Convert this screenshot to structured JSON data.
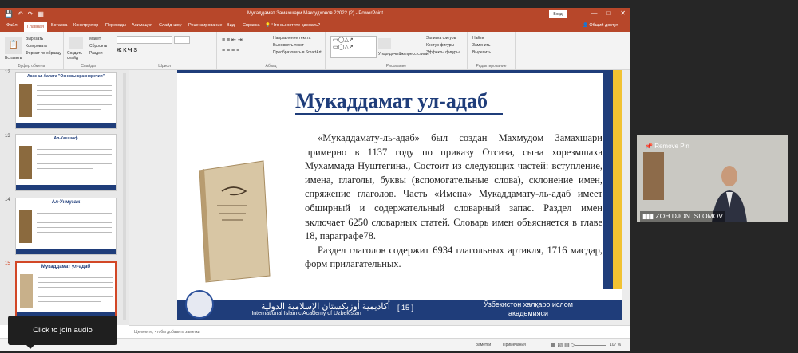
{
  "window": {
    "title": "Мукаддамат Замахшари Максудхонов 22022 (2)  -  PowerPoint",
    "enter_button": "Вход",
    "quick_access": [
      "save-icon",
      "undo-icon",
      "redo-icon",
      "present-icon"
    ],
    "window_controls": [
      "minimize-icon",
      "restore-icon",
      "close-icon"
    ]
  },
  "ribbon_tabs": [
    "Файл",
    "Главная",
    "Вставка",
    "Конструктор",
    "Переходы",
    "Анимация",
    "Слайд-шоу",
    "Рецензирование",
    "Вид",
    "Справка",
    "Что вы хотите сделать?"
  ],
  "ribbon_tab_active": "Главная",
  "share_label": "Общий доступ",
  "ribbon_groups": {
    "clipboard": {
      "caption": "Буфер обмена",
      "paste": "Вставить",
      "cut": "Вырезать",
      "copy": "Копировать",
      "format": "Формат по образцу"
    },
    "slides": {
      "caption": "Слайды",
      "new_slide": "Создать слайд",
      "layout": "Макет",
      "reset": "Сбросить",
      "section": "Раздел"
    },
    "font": {
      "caption": "Шрифт"
    },
    "paragraph": {
      "caption": "Абзац",
      "text_direction": "Направление текста",
      "align_text": "Выровнять текст",
      "smartart": "Преобразовать в SmartArt"
    },
    "drawing": {
      "caption": "Рисование",
      "arrange": "Упорядочить",
      "quick_styles": "Экспресс-стили",
      "fill": "Заливка фигуры",
      "outline": "Контур фигуры",
      "effects": "Эффекты фигуры"
    },
    "editing": {
      "caption": "Редактирование",
      "find": "Найти",
      "replace": "Заменить",
      "select": "Выделить"
    }
  },
  "thumbnails": [
    {
      "num": "12",
      "title": "Асас ал-балага \"Основы красноречия\""
    },
    {
      "num": "13",
      "title": "Ал-Кашшоф"
    },
    {
      "num": "14",
      "title": "Ал-Унмузаж"
    },
    {
      "num": "15",
      "title": "Мукаддамат ул-адаб"
    }
  ],
  "slide": {
    "title": "Мукаддамат ул-адаб",
    "paragraph1": "«Мукаддамату-ль-адаб» был создан Махмудом Замахшари примерно в 1137 году по приказу Отсиза, сына хорезмшаха Мухаммада Нуштегина., Состоит из следующих частей: вступление, имена, глаголы, буквы (вспомогательные слова), склонение имен, спряжение глаголов. Часть «Имена» Мукаддамату-ль-адаб имеет обширный и содержательный словарный запас. Раздел имен включает 6250 словарных статей. Словарь имен объясняется в главе 18, параграфе78.",
    "paragraph2": "Раздел глаголов содержит 6934 глагольных артикля, 1716 масдар, форм прилагательных.",
    "footer_arabic": "أكاديمية أوزبكستان الإسلامية الدولية",
    "footer_english": "International Islamic Academy of Uzbekistan",
    "page_number": "[ 15 ]",
    "footer_uzbek_line1": "Ўзбекистон халқаро ислом",
    "footer_uzbek_line2": "академияси"
  },
  "notes_placeholder": "Щелкните, чтобы добавить заметки",
  "status": {
    "notes": "Заметки",
    "comments": "Примечания",
    "zoom": "107 %"
  },
  "video_tile": {
    "remove_pin": "Remove Pin",
    "name": "ZOH DJON ISLOMOV"
  },
  "join_audio": "Click to join audio",
  "colors": {
    "ppt_accent": "#b7472a",
    "slide_navy": "#1f3d7a",
    "slide_gold": "#f1c232"
  }
}
